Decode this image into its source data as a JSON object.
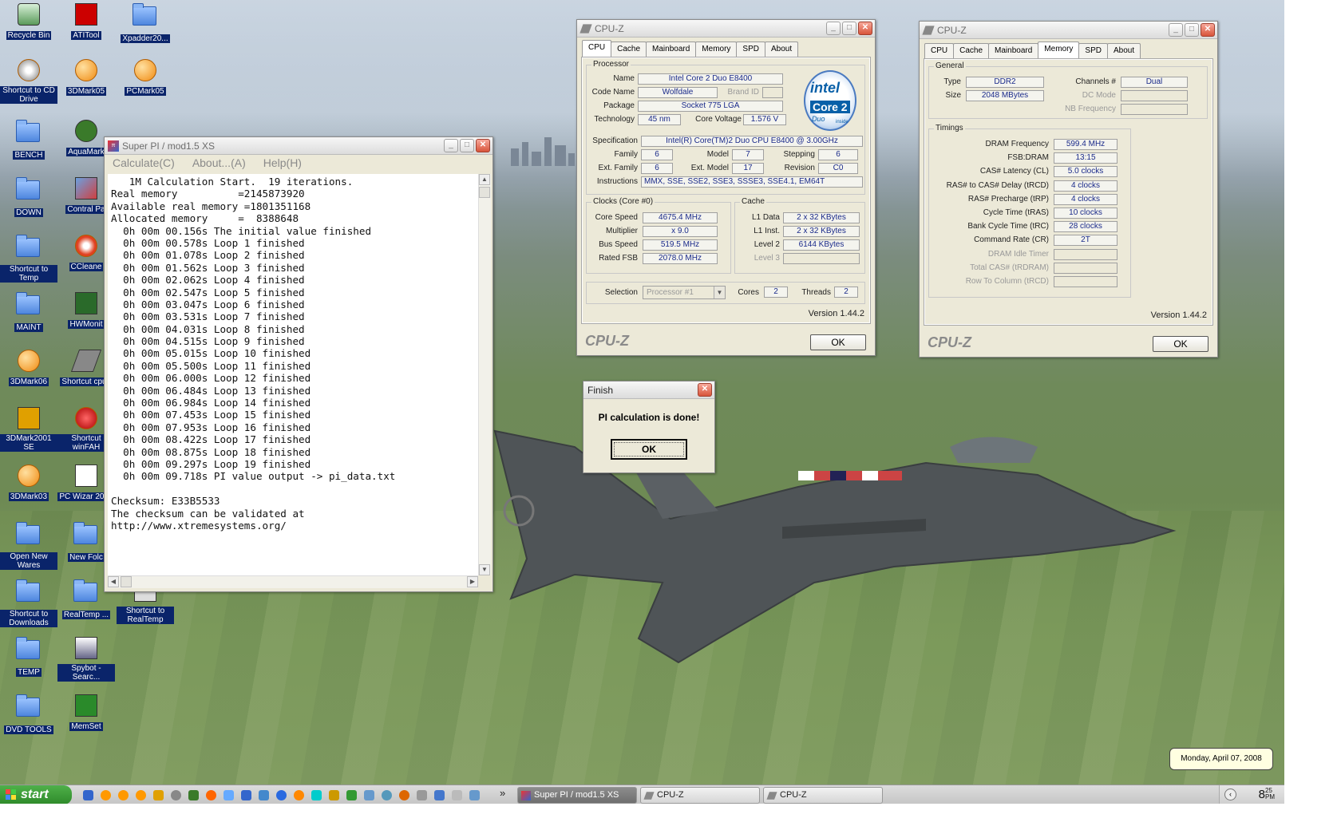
{
  "desktop_icons": [
    {
      "label": "Recycle Bin",
      "icon": "recycle-bin-icon"
    },
    {
      "label": "ATITool",
      "icon": "atitool-icon"
    },
    {
      "label": "Xpadder20...",
      "icon": "folder-icon"
    },
    {
      "label": "Shortcut to CD Drive",
      "icon": "cd-drive-icon"
    },
    {
      "label": "3DMark05",
      "icon": "3dmark-icon"
    },
    {
      "label": "PCMark05",
      "icon": "pcmark-icon"
    },
    {
      "label": "BENCH",
      "icon": "folder-icon"
    },
    {
      "label": "AquaMark",
      "icon": "aquamark-icon"
    },
    {
      "label": "DOWN",
      "icon": "folder-icon"
    },
    {
      "label": "Contral Pa",
      "icon": "control-panel-icon"
    },
    {
      "label": "Shortcut to Temp",
      "icon": "folder-icon"
    },
    {
      "label": "CCleane",
      "icon": "ccleaner-icon"
    },
    {
      "label": "MAINT",
      "icon": "folder-icon"
    },
    {
      "label": "HWMonit",
      "icon": "hwmonitor-icon"
    },
    {
      "label": "3DMark06",
      "icon": "3dmark-icon"
    },
    {
      "label": "Shortcut cpuz",
      "icon": "cpuz-icon"
    },
    {
      "label": "3DMark2001 SE",
      "icon": "3dmark2001-icon"
    },
    {
      "label": "Shortcut winFAH",
      "icon": "winfah-icon"
    },
    {
      "label": "3DMark03",
      "icon": "3dmark-icon"
    },
    {
      "label": "PC Wizar 2008",
      "icon": "pcwizard-icon"
    },
    {
      "label": "Open New Wares",
      "icon": "folder-icon"
    },
    {
      "label": "New Folc",
      "icon": "folder-icon"
    },
    {
      "label": "Shortcut to Downloads",
      "icon": "folder-icon"
    },
    {
      "label": "RealTemp ...",
      "icon": "folder-icon"
    },
    {
      "label": "Shortcut to RealTemp",
      "icon": "realtemp-icon"
    },
    {
      "label": "TEMP",
      "icon": "folder-icon"
    },
    {
      "label": "Spybot - Searc...",
      "icon": "spybot-icon"
    },
    {
      "label": "DVD TOOLS",
      "icon": "folder-icon"
    },
    {
      "label": "MemSet",
      "icon": "memset-icon"
    }
  ],
  "superpi": {
    "title": "Super PI / mod1.5 XS",
    "menu": [
      "Calculate(C)",
      "About...(A)",
      "Help(H)"
    ],
    "lines": [
      "   1M Calculation Start.  19 iterations.",
      "Real memory          =2145873920",
      "Available real memory =1801351168",
      "Allocated memory     =  8388648",
      "  0h 00m 00.156s The initial value finished",
      "  0h 00m 00.578s Loop 1 finished",
      "  0h 00m 01.078s Loop 2 finished",
      "  0h 00m 01.562s Loop 3 finished",
      "  0h 00m 02.062s Loop 4 finished",
      "  0h 00m 02.547s Loop 5 finished",
      "  0h 00m 03.047s Loop 6 finished",
      "  0h 00m 03.531s Loop 7 finished",
      "  0h 00m 04.031s Loop 8 finished",
      "  0h 00m 04.515s Loop 9 finished",
      "  0h 00m 05.015s Loop 10 finished",
      "  0h 00m 05.500s Loop 11 finished",
      "  0h 00m 06.000s Loop 12 finished",
      "  0h 00m 06.484s Loop 13 finished",
      "  0h 00m 06.984s Loop 14 finished",
      "  0h 00m 07.453s Loop 15 finished",
      "  0h 00m 07.953s Loop 16 finished",
      "  0h 00m 08.422s Loop 17 finished",
      "  0h 00m 08.875s Loop 18 finished",
      "  0h 00m 09.297s Loop 19 finished",
      "  0h 00m 09.718s PI value output -> pi_data.txt",
      "",
      "Checksum: E33B5533",
      "The checksum can be validated at",
      "http://www.xtremesystems.org/"
    ]
  },
  "finish": {
    "title": "Finish",
    "message": "PI calculation is done!",
    "ok": "OK"
  },
  "cpuz1": {
    "title": "CPU-Z",
    "tabs": [
      "CPU",
      "Cache",
      "Mainboard",
      "Memory",
      "SPD",
      "About"
    ],
    "processor_label": "Processor",
    "name_label": "Name",
    "name": "Intel Core 2 Duo E8400",
    "codename_label": "Code Name",
    "codename": "Wolfdale",
    "brandid_label": "Brand ID",
    "package_label": "Package",
    "package": "Socket 775 LGA",
    "technology_label": "Technology",
    "technology": "45 nm",
    "corevoltage_label": "Core Voltage",
    "corevoltage": "1.576 V",
    "spec_label": "Specification",
    "spec": "Intel(R) Core(TM)2 Duo CPU     E8400  @ 3.00GHz",
    "family_label": "Family",
    "family": "6",
    "model_label": "Model",
    "model": "7",
    "stepping_label": "Stepping",
    "stepping": "6",
    "extfamily_label": "Ext. Family",
    "extfamily": "6",
    "extmodel_label": "Ext. Model",
    "extmodel": "17",
    "revision_label": "Revision",
    "revision": "C0",
    "instructions_label": "Instructions",
    "instructions": "MMX, SSE, SSE2, SSE3, SSSE3, SSE4.1, EM64T",
    "clocks_label": "Clocks (Core #0)",
    "corespeed_label": "Core Speed",
    "corespeed": "4675.4 MHz",
    "multiplier_label": "Multiplier",
    "multiplier": "x 9.0",
    "busspeed_label": "Bus Speed",
    "busspeed": "519.5 MHz",
    "ratedfsb_label": "Rated FSB",
    "ratedfsb": "2078.0 MHz",
    "cache_label": "Cache",
    "l1data_label": "L1 Data",
    "l1data": "2 x 32 KBytes",
    "l1inst_label": "L1 Inst.",
    "l1inst": "2 x 32 KBytes",
    "level2_label": "Level 2",
    "level2": "6144 KBytes",
    "level3_label": "Level 3",
    "selection_label": "Selection",
    "selection": "Processor #1",
    "cores_label": "Cores",
    "cores": "2",
    "threads_label": "Threads",
    "threads": "2",
    "version": "Version 1.44.2",
    "brand": "CPU-Z",
    "ok": "OK",
    "logo_top": "intel",
    "logo_mid": "Core 2",
    "logo_sub": "Duo",
    "logo_foot": "inside"
  },
  "cpuz2": {
    "title": "CPU-Z",
    "tabs": [
      "CPU",
      "Cache",
      "Mainboard",
      "Memory",
      "SPD",
      "About"
    ],
    "general_label": "General",
    "type_label": "Type",
    "type": "DDR2",
    "channels_label": "Channels #",
    "channels": "Dual",
    "size_label": "Size",
    "size": "2048 MBytes",
    "dcmode_label": "DC Mode",
    "nbfreq_label": "NB Frequency",
    "timings_label": "Timings",
    "rows": [
      {
        "label": "DRAM Frequency",
        "value": "599.4 MHz",
        "dim": false
      },
      {
        "label": "FSB:DRAM",
        "value": "13:15",
        "dim": false
      },
      {
        "label": "CAS# Latency (CL)",
        "value": "5.0 clocks",
        "dim": false
      },
      {
        "label": "RAS# to CAS# Delay (tRCD)",
        "value": "4 clocks",
        "dim": false
      },
      {
        "label": "RAS# Precharge (tRP)",
        "value": "4 clocks",
        "dim": false
      },
      {
        "label": "Cycle Time (tRAS)",
        "value": "10 clocks",
        "dim": false
      },
      {
        "label": "Bank Cycle Time (tRC)",
        "value": "28 clocks",
        "dim": false
      },
      {
        "label": "Command Rate (CR)",
        "value": "2T",
        "dim": false
      },
      {
        "label": "DRAM Idle Timer",
        "value": "",
        "dim": true
      },
      {
        "label": "Total CAS# (tRDRAM)",
        "value": "",
        "dim": true
      },
      {
        "label": "Row To Column (tRCD)",
        "value": "",
        "dim": true
      }
    ],
    "version": "Version 1.44.2",
    "brand": "CPU-Z",
    "ok": "OK"
  },
  "taskbar": {
    "start": "start",
    "tasks": [
      "Super PI / mod1.5 XS",
      "CPU-Z",
      "CPU-Z"
    ],
    "clock_hour": "8",
    "clock_min": "25",
    "clock_ampm": "PM",
    "date_tooltip": "Monday, April 07, 2008"
  },
  "colors": {
    "value_text": "#1a2a8a",
    "label_bg": "#0a246a",
    "start_green": "#3a9a35"
  }
}
